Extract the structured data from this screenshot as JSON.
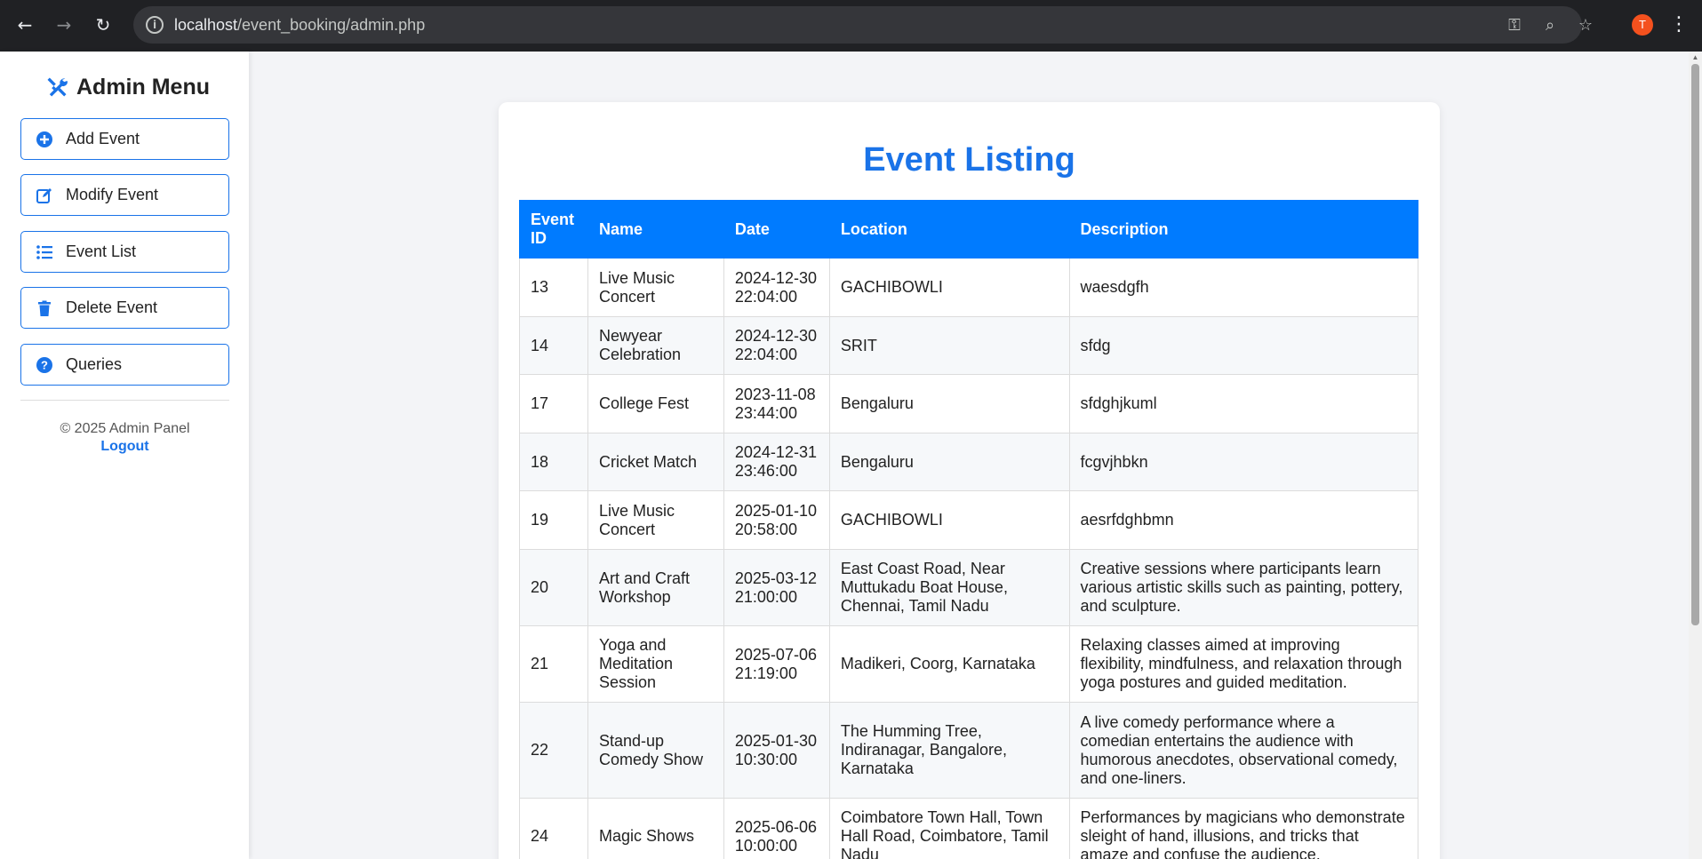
{
  "browser": {
    "url_host": "localhost",
    "url_path": "/event_booking/admin.php",
    "profile_initial": "T"
  },
  "sidebar": {
    "title": "Admin Menu",
    "title_icon": "tools-icon",
    "items": [
      {
        "label": "Add Event",
        "icon": "plus-circle-icon"
      },
      {
        "label": "Modify Event",
        "icon": "edit-icon"
      },
      {
        "label": "Event List",
        "icon": "list-icon"
      },
      {
        "label": "Delete Event",
        "icon": "trash-icon"
      },
      {
        "label": "Queries",
        "icon": "question-circle-icon"
      }
    ],
    "footer_text": "© 2025 Admin Panel",
    "logout_label": "Logout"
  },
  "main": {
    "title": "Event Listing",
    "columns": [
      "Event ID",
      "Name",
      "Date",
      "Location",
      "Description"
    ],
    "rows": [
      {
        "id": "13",
        "name": "Live Music Concert",
        "date": "2024-12-30 22:04:00",
        "location": "GACHIBOWLI",
        "description": "waesdgfh"
      },
      {
        "id": "14",
        "name": "Newyear Celebration",
        "date": "2024-12-30 22:04:00",
        "location": "SRIT",
        "description": "sfdg"
      },
      {
        "id": "17",
        "name": "College Fest",
        "date": "2023-11-08 23:44:00",
        "location": "Bengaluru",
        "description": "sfdghjkuml"
      },
      {
        "id": "18",
        "name": "Cricket Match",
        "date": "2024-12-31 23:46:00",
        "location": "Bengaluru",
        "description": "fcgvjhbkn"
      },
      {
        "id": "19",
        "name": "Live Music Concert",
        "date": "2025-01-10 20:58:00",
        "location": "GACHIBOWLI",
        "description": "aesrfdghbmn"
      },
      {
        "id": "20",
        "name": "Art and Craft Workshop",
        "date": "2025-03-12 21:00:00",
        "location": "East Coast Road, Near Muttukadu Boat House, Chennai, Tamil Nadu",
        "description": "Creative sessions where participants learn various artistic skills such as painting, pottery, and sculpture."
      },
      {
        "id": "21",
        "name": "Yoga and Meditation Session",
        "date": "2025-07-06 21:19:00",
        "location": "Madikeri, Coorg, Karnataka",
        "description": "Relaxing classes aimed at improving flexibility, mindfulness, and relaxation through yoga postures and guided meditation."
      },
      {
        "id": "22",
        "name": "Stand-up Comedy Show",
        "date": "2025-01-30 10:30:00",
        "location": "The Humming Tree, Indiranagar, Bangalore, Karnataka",
        "description": "A live comedy performance where a comedian entertains the audience with humorous anecdotes, observational comedy, and one-liners."
      },
      {
        "id": "24",
        "name": "Magic Shows",
        "date": "2025-06-06 10:00:00",
        "location": "Coimbatore Town Hall, Town Hall Road, Coimbatore, Tamil Nadu",
        "description": "Performances by magicians who demonstrate sleight of hand, illusions, and tricks that amaze and confuse the audience."
      }
    ]
  },
  "colors": {
    "accent": "#1a73e8",
    "table_header": "#007bff"
  }
}
